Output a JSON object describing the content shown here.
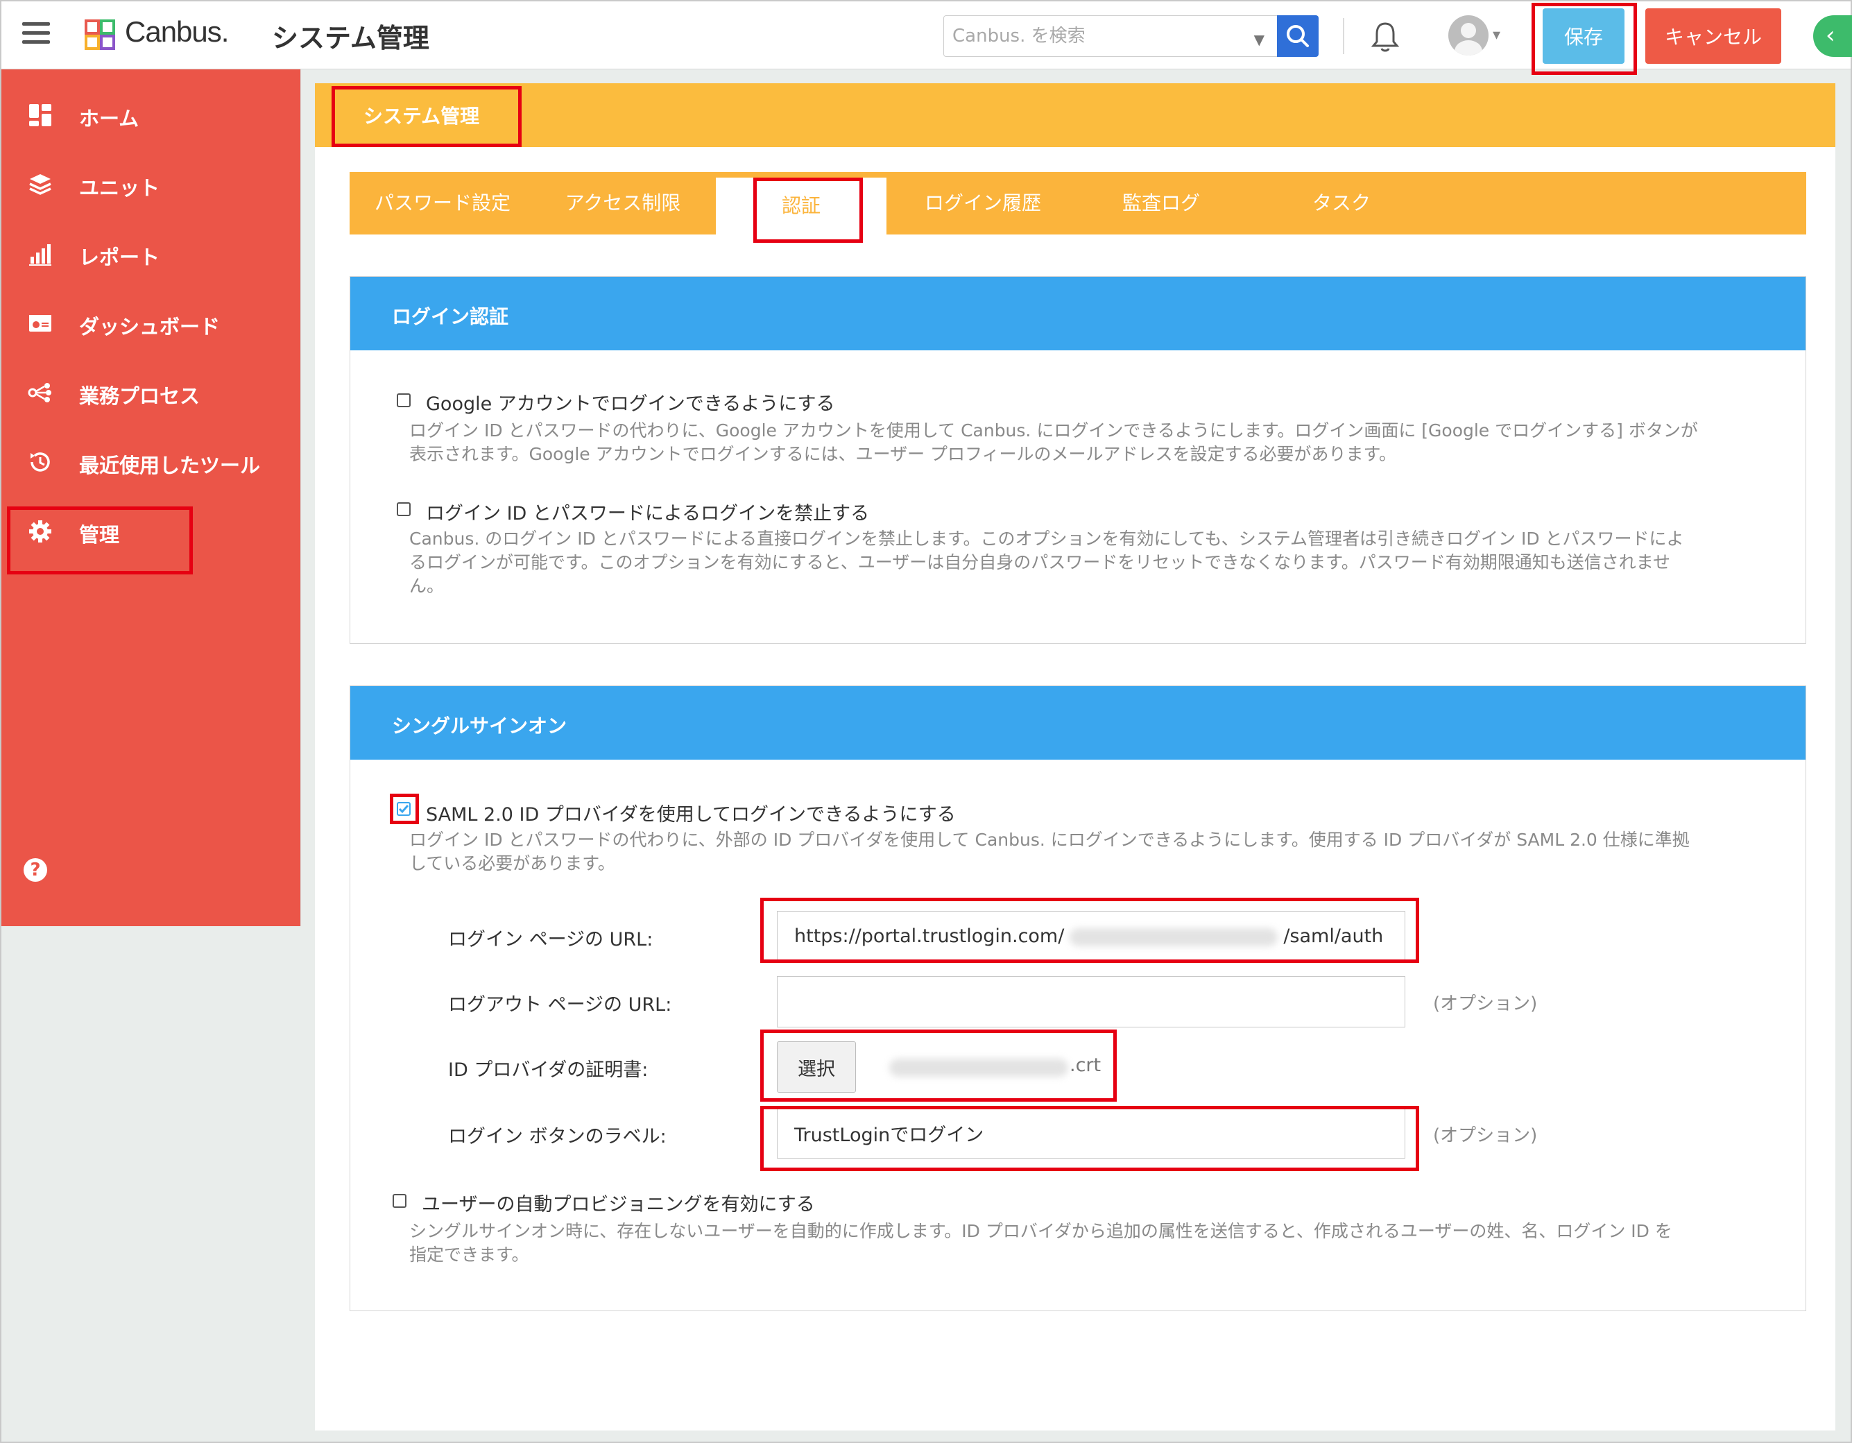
{
  "header": {
    "logo_text": "Canbus.",
    "app_title": "システム管理",
    "search_placeholder": "Canbus. を検索",
    "save_label": "保存",
    "cancel_label": "キャンセル",
    "icons": [
      "hamburger-icon",
      "search-icon",
      "bell-icon",
      "avatar-icon",
      "chevron-left-icon"
    ]
  },
  "sidebar": {
    "items": [
      {
        "label": "ホーム",
        "icon": "home-grid-icon"
      },
      {
        "label": "ユニット",
        "icon": "layers-icon"
      },
      {
        "label": "レポート",
        "icon": "bar-chart-icon"
      },
      {
        "label": "ダッシュボード",
        "icon": "dashboard-icon"
      },
      {
        "label": "業務プロセス",
        "icon": "process-icon"
      },
      {
        "label": "最近使用したツール",
        "icon": "history-icon"
      },
      {
        "label": "管理",
        "icon": "gear-icon"
      }
    ],
    "help_icon": "?"
  },
  "page": {
    "title": "システム管理",
    "tabs": [
      "パスワード設定",
      "アクセス制限",
      "認証",
      "ログイン履歴",
      "監査ログ",
      "タスク"
    ],
    "active_tab": "認証"
  },
  "login_auth": {
    "title": "ログイン認証",
    "google": {
      "label": "Google アカウントでログインできるようにする",
      "desc1": "ログイン ID とパスワードの代わりに、Google アカウントを使用して Canbus. にログインできるようにします。ログイン画面に [Google でログインする] ボタンが",
      "desc2": "表示されます。Google アカウントでログインするには、ユーザー プロフィールのメールアドレスを設定する必要があります。",
      "checked": false
    },
    "disable_password": {
      "label": "ログイン ID とパスワードによるログインを禁止する",
      "desc1": "Canbus. のログイン ID とパスワードによる直接ログインを禁止します。このオプションを有効にしても、システム管理者は引き続きログイン ID とパスワードによ",
      "desc2": "るログインが可能です。このオプションを有効にすると、ユーザーは自分自身のパスワードをリセットできなくなります。パスワード有効期限通知も送信されませ",
      "desc3": "ん。",
      "checked": false
    }
  },
  "sso": {
    "title": "シングルサインオン",
    "saml": {
      "label": "SAML 2.0 ID プロバイダを使用してログインできるようにする",
      "desc1": "ログイン ID とパスワードの代わりに、外部の ID プロバイダを使用して Canbus. にログインできるようにします。使用する ID プロバイダが SAML 2.0 仕様に準拠",
      "desc2": "している必要があります。",
      "checked": true
    },
    "fields": {
      "login_url_label": "ログイン ページの URL:",
      "login_url_prefix": "https://portal.trustlogin.com/",
      "login_url_suffix": "/saml/auth",
      "logout_url_label": "ログアウト ページの URL:",
      "logout_url_value": "",
      "cert_label": "ID プロバイダの証明書:",
      "cert_button": "選択",
      "cert_ext": ".crt",
      "button_label_label": "ログイン ボタンのラベル:",
      "button_label_value": "TrustLoginでログイン",
      "optional": "(オプション)"
    },
    "provisioning": {
      "label": "ユーザーの自動プロビジョニングを有効にする",
      "desc1": "シングルサインオン時に、存在しないユーザーを自動的に作成します。ID プロバイダから追加の属性を送信すると、作成されるユーザーの姓、名、ログイン ID を",
      "desc2": "指定できます。",
      "checked": false
    }
  },
  "colors": {
    "sidebar": "#eb5548",
    "accent_orange": "#fbbc3e",
    "panel_blue": "#3aa6ee",
    "save_blue": "#5bbce8",
    "cancel_red": "#ee5a46",
    "highlight_red": "#e60012"
  }
}
